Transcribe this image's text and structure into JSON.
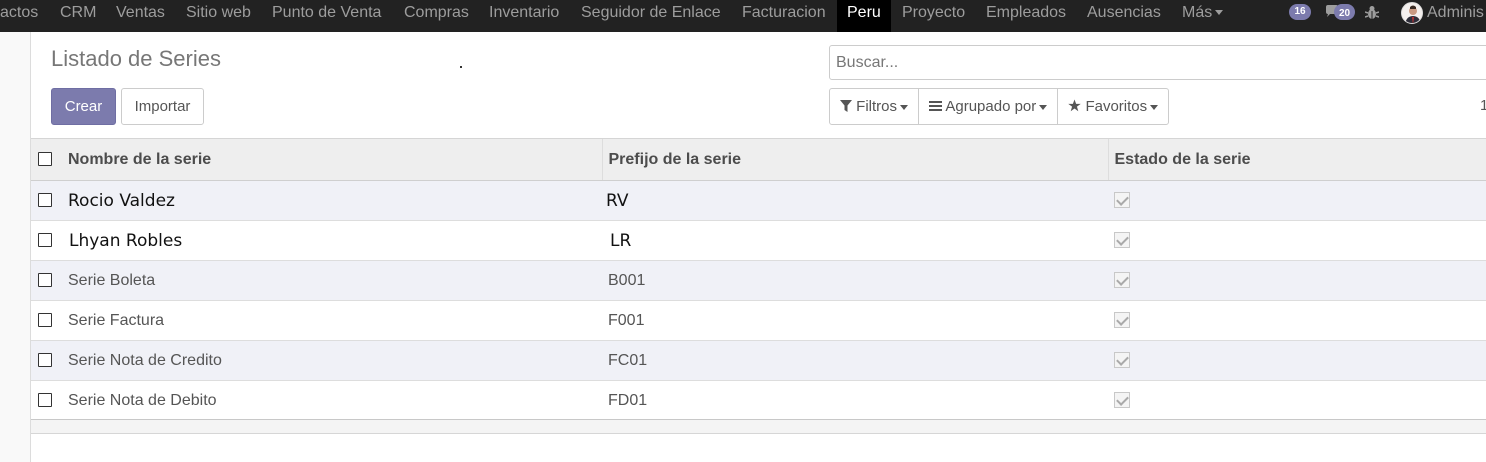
{
  "navbar": {
    "apps": [
      "actos",
      "CRM",
      "Ventas",
      "Sitio web",
      "Punto de Venta",
      "Compras",
      "Inventario",
      "Seguidor de Enlace",
      "Facturacion",
      "Peru",
      "Proyecto",
      "Empleados",
      "Ausencias"
    ],
    "active_app": "Peru",
    "more_label": "Más",
    "activity_count": "16",
    "messages_count": "20",
    "user_label": "Adminis"
  },
  "page": {
    "title": "Listado de Series",
    "create_label": "Crear",
    "import_label": "Importar"
  },
  "search": {
    "placeholder": "Buscar..."
  },
  "filters": {
    "filters_label": "Filtros",
    "group_by_label": "Agrupado por",
    "favorites_label": "Favoritos"
  },
  "pager": {
    "text": "1"
  },
  "table": {
    "columns": [
      "Nombre de la serie",
      "Prefijo de la serie",
      "Estado de la serie"
    ],
    "rows": [
      {
        "name": "Rocio Valdez",
        "prefix": "RV",
        "active": true
      },
      {
        "name": "Lhyan Robles",
        "prefix": "LR",
        "active": true
      },
      {
        "name": "Serie Boleta",
        "prefix": "B001",
        "active": true
      },
      {
        "name": "Serie Factura",
        "prefix": "F001",
        "active": true
      },
      {
        "name": "Serie Nota de Credito",
        "prefix": "FC01",
        "active": true
      },
      {
        "name": "Serie Nota de Debito",
        "prefix": "FD01",
        "active": true
      }
    ]
  },
  "colors": {
    "navbar_bg": "#222222",
    "primary": "#7c7bad",
    "row_alt": "#f0f1f7"
  }
}
